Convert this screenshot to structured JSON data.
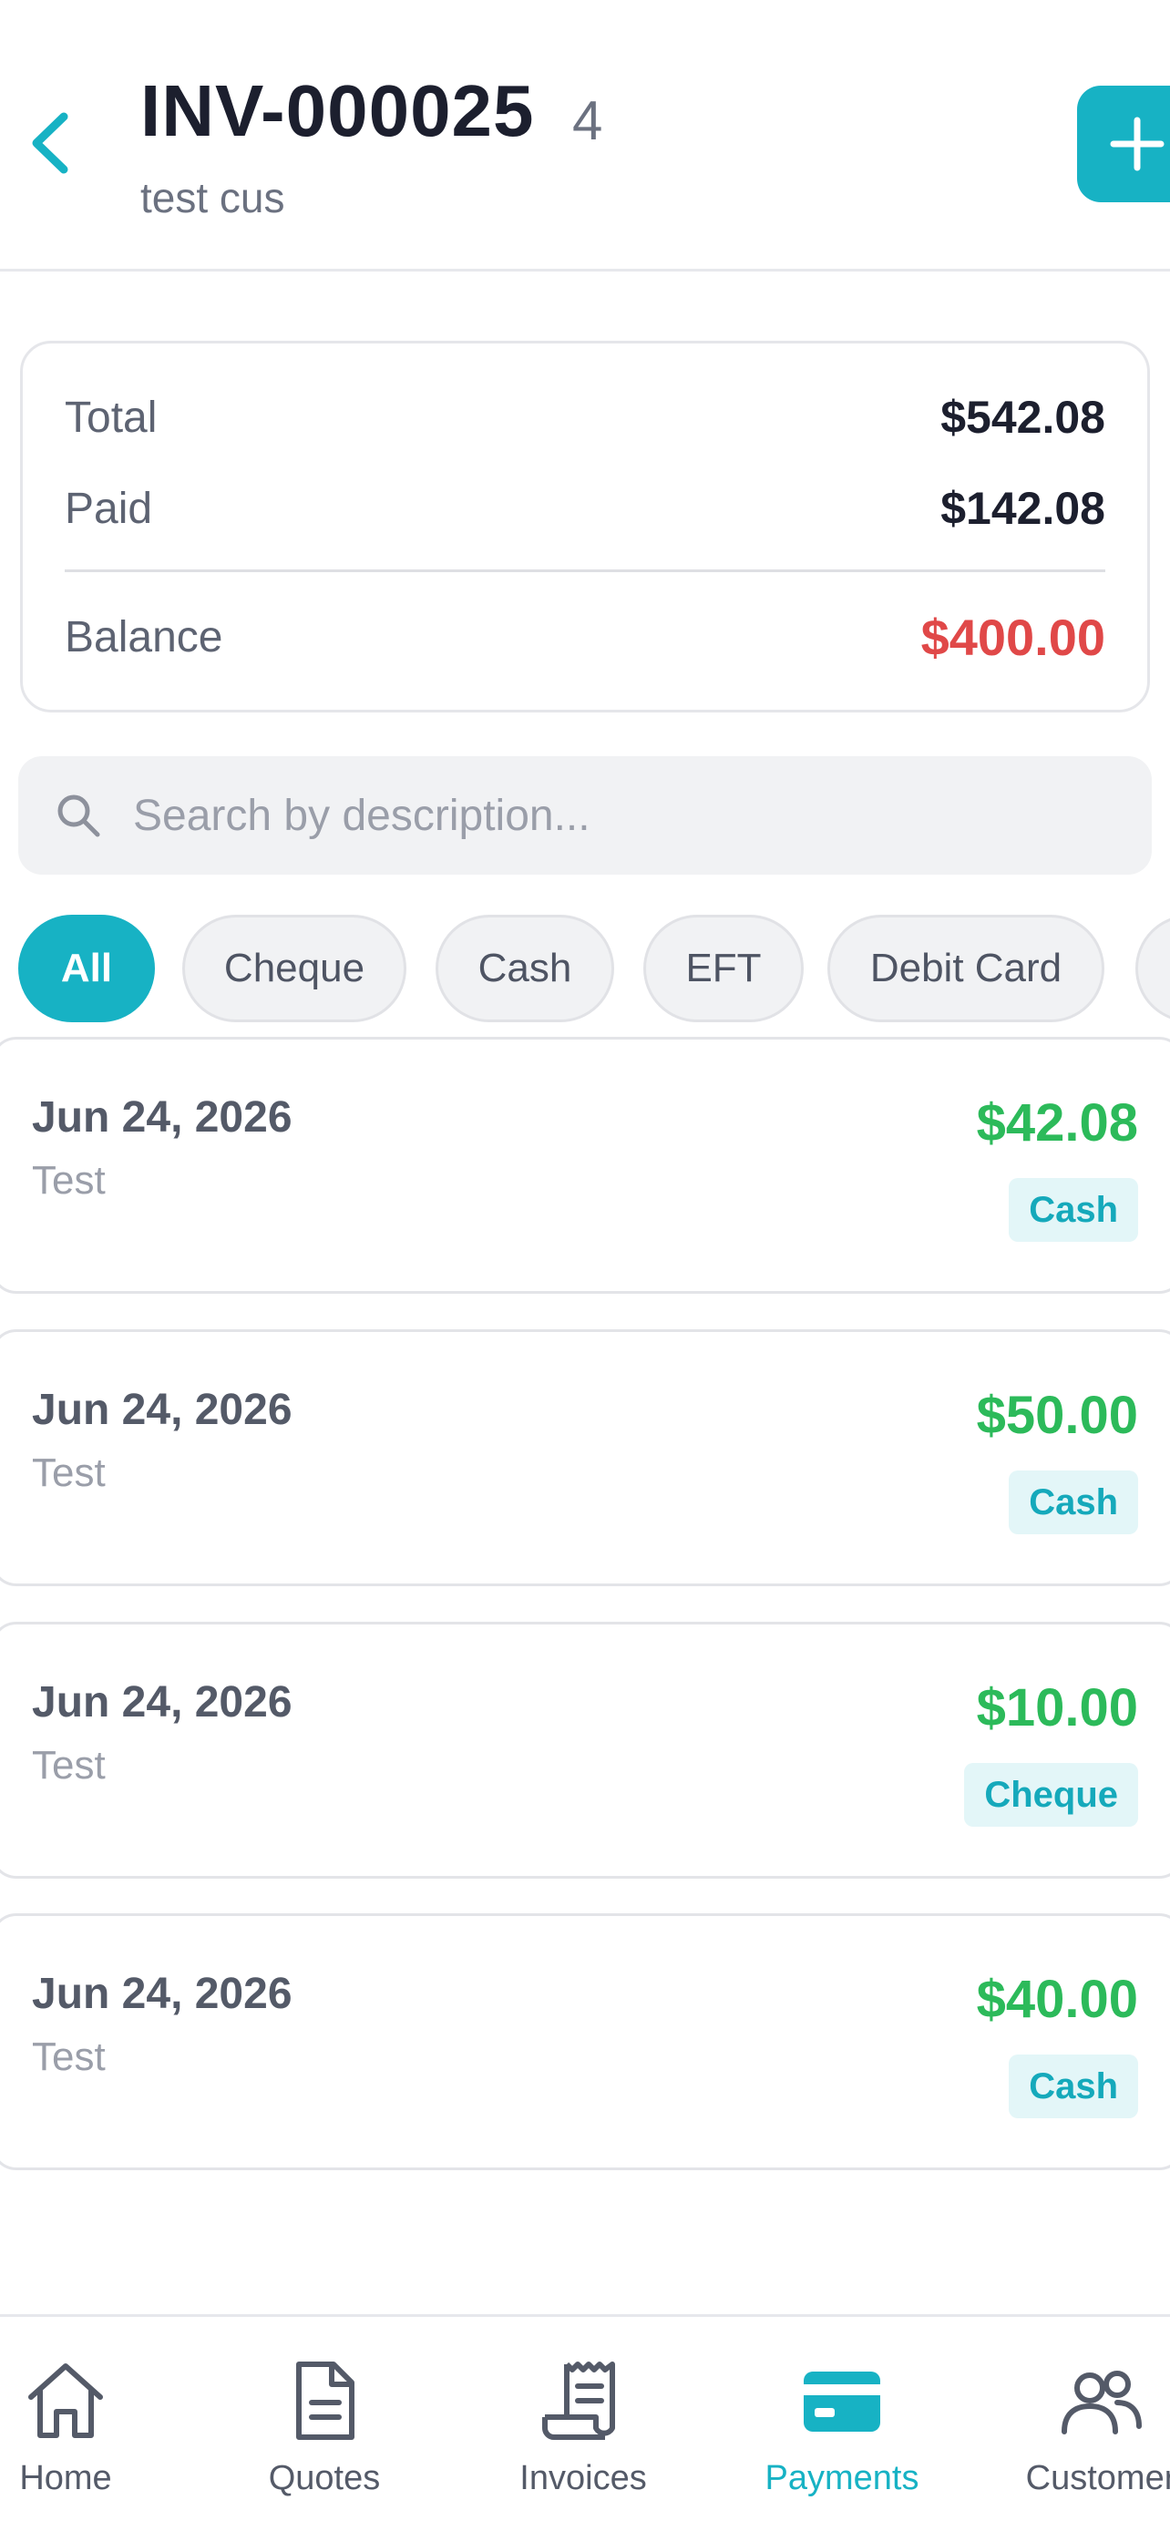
{
  "header": {
    "title": "INV-000025",
    "count": "4",
    "subtitle": "test cus"
  },
  "summary": {
    "total_label": "Total",
    "total_value": "$542.08",
    "paid_label": "Paid",
    "paid_value": "$142.08",
    "balance_label": "Balance",
    "balance_value": "$400.00"
  },
  "search": {
    "placeholder": "Search by description..."
  },
  "filters": [
    "All",
    "Cheque",
    "Cash",
    "EFT",
    "Debit Card"
  ],
  "active_filter": "All",
  "payments": [
    {
      "date": "Jun 24, 2026",
      "description": "Test",
      "amount": "$42.08",
      "method": "Cash"
    },
    {
      "date": "Jun 24, 2026",
      "description": "Test",
      "amount": "$50.00",
      "method": "Cash"
    },
    {
      "date": "Jun 24, 2026",
      "description": "Test",
      "amount": "$10.00",
      "method": "Cheque"
    },
    {
      "date": "Jun 24, 2026",
      "description": "Test",
      "amount": "$40.00",
      "method": "Cash"
    }
  ],
  "nav": {
    "items": [
      {
        "label": "Home",
        "icon": "home-icon"
      },
      {
        "label": "Quotes",
        "icon": "document-icon"
      },
      {
        "label": "Invoices",
        "icon": "receipt-icon"
      },
      {
        "label": "Payments",
        "icon": "credit-card-icon"
      },
      {
        "label": "Customer",
        "icon": "users-icon"
      }
    ],
    "active": "Payments"
  },
  "colors": {
    "accent": "#17b2c4",
    "balance_due": "#e04848",
    "amount_positive": "#2cba5a"
  }
}
